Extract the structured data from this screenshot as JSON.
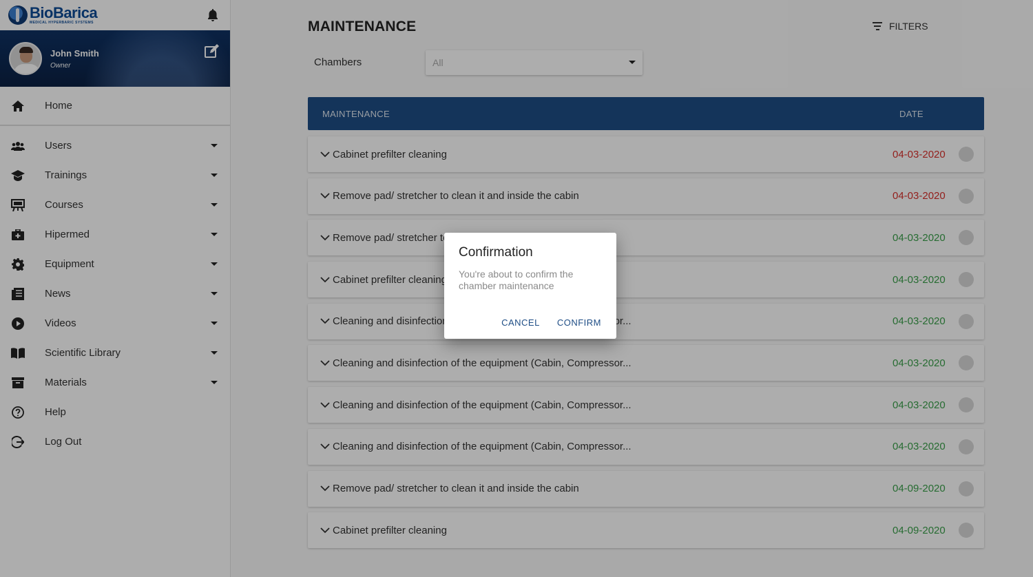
{
  "brand": {
    "name": "BioBarica",
    "subtitle": "MEDICAL HYPERBARIC SYSTEMS"
  },
  "profile": {
    "name": "John Smith",
    "role": "Owner"
  },
  "nav": {
    "home": "Home",
    "items": [
      {
        "label": "Users",
        "icon": "users-icon"
      },
      {
        "label": "Trainings",
        "icon": "graduation-cap-icon"
      },
      {
        "label": "Courses",
        "icon": "easel-icon"
      },
      {
        "label": "Hipermed",
        "icon": "medical-kit-icon"
      },
      {
        "label": "Equipment",
        "icon": "gear-icon"
      },
      {
        "label": "News",
        "icon": "newspaper-icon"
      },
      {
        "label": "Videos",
        "icon": "play-icon"
      },
      {
        "label": "Scientific Library",
        "icon": "book-icon"
      },
      {
        "label": "Materials",
        "icon": "archive-icon"
      }
    ],
    "help": "Help",
    "logout": "Log Out"
  },
  "main": {
    "title": "MAINTENANCE",
    "filters_label": "FILTERS",
    "chambers_label": "Chambers",
    "chambers_value": "All"
  },
  "table": {
    "col_maintenance": "MAINTENANCE",
    "col_date": "DATE",
    "rows": [
      {
        "title": "Cabinet prefilter cleaning",
        "date": "04-03-2020",
        "status": "overdue"
      },
      {
        "title": "Remove pad/ stretcher to clean it and inside the cabin",
        "date": "04-03-2020",
        "status": "overdue"
      },
      {
        "title": "Remove pad/ stretcher to clean it and inside the cabin",
        "date": "04-03-2020",
        "status": "ok"
      },
      {
        "title": "Cabinet prefilter cleaning",
        "date": "04-03-2020",
        "status": "ok"
      },
      {
        "title": "Cleaning and disinfection of the equipment (Cabin, Compressor...",
        "date": "04-03-2020",
        "status": "ok"
      },
      {
        "title": "Cleaning and disinfection of the equipment (Cabin, Compressor...",
        "date": "04-03-2020",
        "status": "ok"
      },
      {
        "title": "Cleaning and disinfection of the equipment (Cabin, Compressor...",
        "date": "04-03-2020",
        "status": "ok"
      },
      {
        "title": "Cleaning and disinfection of the equipment (Cabin, Compressor...",
        "date": "04-03-2020",
        "status": "ok"
      },
      {
        "title": "Remove pad/ stretcher to clean it and inside the cabin",
        "date": "04-09-2020",
        "status": "ok"
      },
      {
        "title": "Cabinet prefilter cleaning",
        "date": "04-09-2020",
        "status": "ok"
      }
    ]
  },
  "dialog": {
    "title": "Confirmation",
    "message": "You're about to confirm the chamber maintenance",
    "cancel": "CANCEL",
    "confirm": "CONFIRM"
  },
  "colors": {
    "primary": "#1e4d85",
    "overdue": "#d9302c",
    "ok": "#3aa04a",
    "profile_bg": "#0e2c56"
  }
}
